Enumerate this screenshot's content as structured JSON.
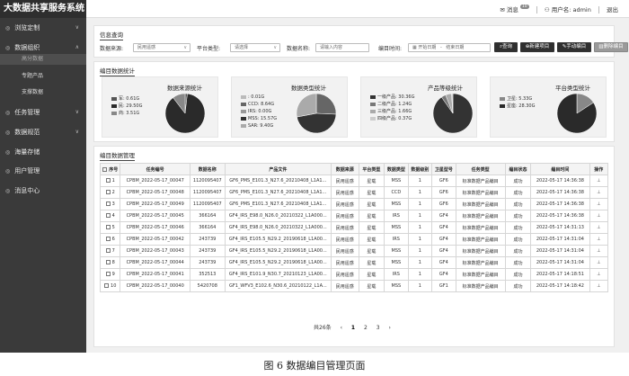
{
  "app": {
    "title": "大数据共享服务系统"
  },
  "topbar": {
    "messages_label": "消息",
    "messages_count": "10",
    "user_label": "用户名: admin",
    "logout_label": "退出"
  },
  "sidebar": {
    "items": [
      {
        "label": "浏览定制",
        "icon": "◎",
        "chev": "∨"
      },
      {
        "label": "数据组织",
        "icon": "◎",
        "chev": "∧"
      },
      {
        "label": "任务管理",
        "icon": "◎",
        "chev": "∨"
      },
      {
        "label": "数据规范",
        "icon": "◎",
        "chev": "∨"
      },
      {
        "label": "海量存储",
        "icon": "◎",
        "chev": ""
      },
      {
        "label": "用户管理",
        "icon": "◎",
        "chev": ""
      },
      {
        "label": "消息中心",
        "icon": "◎",
        "chev": ""
      }
    ],
    "subitems": [
      {
        "label": "高分数据"
      },
      {
        "label": "专题产品"
      },
      {
        "label": "支撑数据"
      }
    ]
  },
  "query": {
    "title": "信息查询",
    "source_label": "数据来源:",
    "source_value": "民用遥感",
    "platform_label": "平台类型:",
    "platform_placeholder": "请选择",
    "name_label": "数据名称:",
    "name_placeholder": "请输入内容",
    "time_label": "编目时间:",
    "start_placeholder": "开始日期",
    "range_sep": "-",
    "end_placeholder": "结束日期",
    "buttons": {
      "search": "查询",
      "new": "新建项目",
      "manual": "手动编目",
      "delete": "删除编目"
    }
  },
  "stats": {
    "title": "编目数据统计",
    "cards": [
      {
        "title": "数据来源统计",
        "legend": [
          {
            "label": "军: 0.61G",
            "color": "#555555"
          },
          {
            "label": "民: 29.50G",
            "color": "#2a2a2a"
          },
          {
            "label": "商: 3.51G",
            "color": "#888888"
          }
        ]
      },
      {
        "title": "数据类型统计",
        "legend": [
          {
            "label": ": 0.01G",
            "color": "#bbbbbb"
          },
          {
            "label": "CCD: 8.64G",
            "color": "#666666"
          },
          {
            "label": "IRS: 0.00G",
            "color": "#999999"
          },
          {
            "label": "MSS: 15.57G",
            "color": "#333333"
          },
          {
            "label": "SAR: 9.40G",
            "color": "#aaaaaa"
          }
        ]
      },
      {
        "title": "产品等级统计",
        "legend": [
          {
            "label": "一级产品: 30.36G",
            "color": "#333333"
          },
          {
            "label": "二级产品: 1.24G",
            "color": "#777777"
          },
          {
            "label": "三级产品: 1.66G",
            "color": "#aaaaaa"
          },
          {
            "label": "四级产品: 0.37G",
            "color": "#cccccc"
          }
        ]
      },
      {
        "title": "平台类型统计",
        "legend": [
          {
            "label": "卫星: 5.33G",
            "color": "#888888"
          },
          {
            "label": "星座: 28.30G",
            "color": "#2a2a2a"
          }
        ]
      }
    ]
  },
  "chart_data": [
    {
      "type": "pie",
      "title": "数据来源统计",
      "categories": [
        "军",
        "民",
        "商"
      ],
      "values": [
        0.61,
        29.5,
        3.51
      ]
    },
    {
      "type": "pie",
      "title": "数据类型统计",
      "categories": [
        "",
        "CCD",
        "IRS",
        "MSS",
        "SAR"
      ],
      "values": [
        0.01,
        8.64,
        0.0,
        15.57,
        9.4
      ]
    },
    {
      "type": "pie",
      "title": "产品等级统计",
      "categories": [
        "一级产品",
        "二级产品",
        "三级产品",
        "四级产品"
      ],
      "values": [
        30.36,
        1.24,
        1.66,
        0.37
      ]
    },
    {
      "type": "pie",
      "title": "平台类型统计",
      "categories": [
        "卫星",
        "星座"
      ],
      "values": [
        5.33,
        28.3
      ]
    }
  ],
  "table": {
    "title": "编目数据管理",
    "headers": [
      "序号",
      "任务编号",
      "数据名称",
      "产品文件",
      "数据来源",
      "平台类型",
      "数据类型",
      "数据级别",
      "卫星型号",
      "任务类型",
      "编目状态",
      "编目时间",
      "操作"
    ],
    "rows": [
      [
        "1",
        "CPBM_2022-05-17_00047",
        "1120095407",
        "GF6_PMS_E101.3_N27.6_20210408_L1A1...",
        "民用遥感",
        "星载",
        "MSS",
        "1",
        "GF6",
        "标准数据产品编目",
        "成功",
        "2022-05-17 14:36:38",
        "⊥"
      ],
      [
        "2",
        "CPBM_2022-05-17_00048",
        "1120095407",
        "GF6_PMS_E101.3_N27.6_20210408_L1A1...",
        "民用遥感",
        "星载",
        "CCD",
        "1",
        "GF6",
        "标准数据产品编目",
        "成功",
        "2022-05-17 14:36:38",
        "⊥"
      ],
      [
        "3",
        "CPBM_2022-05-17_00049",
        "1120095407",
        "GF6_PMS_E101.3_N27.6_20210408_L1A1...",
        "民用遥感",
        "星载",
        "MSS",
        "1",
        "GF6",
        "标准数据产品编目",
        "成功",
        "2022-05-17 14:36:38",
        "⊥"
      ],
      [
        "4",
        "CPBM_2022-05-17_00045",
        "366164",
        "GF4_IRS_E98.0_N26.0_20210322_L1A000...",
        "民用遥感",
        "星载",
        "IRS",
        "1",
        "GF4",
        "标准数据产品编目",
        "成功",
        "2022-05-17 14:36:38",
        "⊥"
      ],
      [
        "5",
        "CPBM_2022-05-17_00046",
        "366164",
        "GF4_IRS_E98.0_N26.0_20210322_L1A000...",
        "民用遥感",
        "星载",
        "MSS",
        "1",
        "GF4",
        "标准数据产品编目",
        "成功",
        "2022-05-17 14:31:13",
        "⊥"
      ],
      [
        "6",
        "CPBM_2022-05-17_00042",
        "243739",
        "GF4_IRS_E105.5_N29.2_20190618_L1A00...",
        "民用遥感",
        "星载",
        "IRS",
        "1",
        "GF4",
        "标准数据产品编目",
        "成功",
        "2022-05-17 14:31:04",
        "⊥"
      ],
      [
        "7",
        "CPBM_2022-05-17_00043",
        "243739",
        "GF4_IRS_E105.5_N29.2_20190618_L1A00...",
        "民用遥感",
        "星载",
        "MSS",
        "1",
        "GF4",
        "标准数据产品编目",
        "成功",
        "2022-05-17 14:31:04",
        "⊥"
      ],
      [
        "8",
        "CPBM_2022-05-17_00044",
        "243739",
        "GF4_IRS_E105.5_N29.2_20190618_L1A00...",
        "民用遥感",
        "星载",
        "MSS",
        "1",
        "GF4",
        "标准数据产品编目",
        "成功",
        "2022-05-17 14:31:04",
        "⊥"
      ],
      [
        "9",
        "CPBM_2022-05-17_00041",
        "352513",
        "GF4_IRS_E101.9_N30.7_20210123_L1A00...",
        "民用遥感",
        "星载",
        "IRS",
        "1",
        "GF4",
        "标准数据产品编目",
        "成功",
        "2022-05-17 14:18:51",
        "⊥"
      ],
      [
        "10",
        "CPBM_2022-05-17_00040",
        "5420708",
        "GF1_WFV3_E102.6_N30.6_20210122_L1A...",
        "民用遥感",
        "星载",
        "MSS",
        "1",
        "GF1",
        "标准数据产品编目",
        "成功",
        "2022-05-17 14:18:42",
        "⊥"
      ]
    ]
  },
  "pager": {
    "total": "共26条",
    "prev": "‹",
    "pages": [
      "1",
      "2",
      "3"
    ],
    "next": "›"
  },
  "caption": "图 6  数据编目管理页面"
}
